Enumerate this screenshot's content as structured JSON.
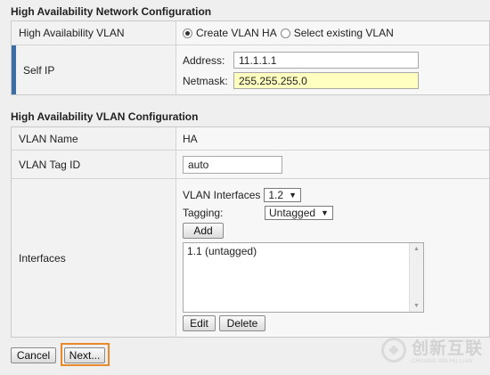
{
  "network_config": {
    "title": "High Availability Network Configuration",
    "ha_vlan": {
      "label": "High Availability VLAN",
      "option_create": "Create VLAN HA",
      "option_select": "Select existing VLAN",
      "selected": "create"
    },
    "self_ip": {
      "label": "Self IP",
      "address_label": "Address:",
      "address_value": "11.1.1.1",
      "netmask_label": "Netmask:",
      "netmask_value": "255.255.255.0"
    }
  },
  "vlan_config": {
    "title": "High Availability VLAN Configuration",
    "vlan_name": {
      "label": "VLAN Name",
      "value": "HA"
    },
    "vlan_tag": {
      "label": "VLAN Tag ID",
      "value": "auto"
    },
    "interfaces": {
      "label": "Interfaces",
      "vlan_interfaces_label": "VLAN Interfaces",
      "vlan_interfaces_value": "1.2",
      "tagging_label": "Tagging:",
      "tagging_value": "Untagged",
      "add_label": "Add",
      "list": [
        "1.1 (untagged)"
      ],
      "edit_label": "Edit",
      "delete_label": "Delete"
    }
  },
  "footer": {
    "cancel_label": "Cancel",
    "next_label": "Next...",
    "next_highlight_color": "#e8892c"
  },
  "watermark": {
    "main": "创新互联",
    "sub": "CHUANG XIN HU LIAN"
  }
}
